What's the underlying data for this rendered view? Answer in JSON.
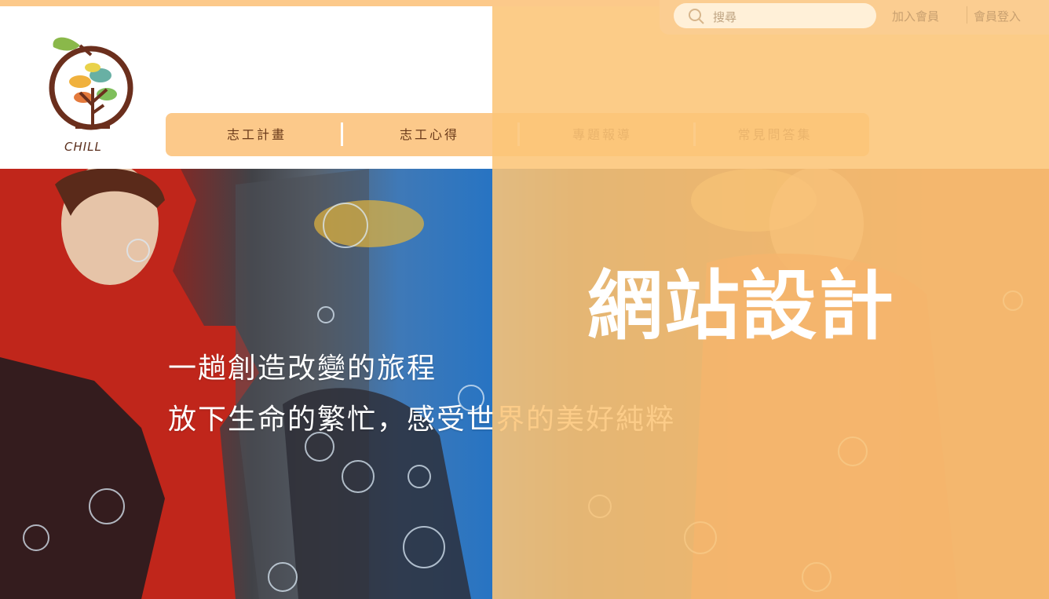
{
  "header": {
    "logo_text": "CHILL",
    "nav": [
      {
        "label": "志工計畫"
      },
      {
        "label": "志工心得"
      },
      {
        "label": "專題報導"
      },
      {
        "label": "常見問答集"
      }
    ],
    "search": {
      "placeholder": "搜尋"
    },
    "links": {
      "join": "加入會員",
      "login": "會員登入"
    }
  },
  "hero": {
    "line1": "一趟創造改變的旅程",
    "line2": "放下生命的繁忙，感受世界的美好純粹"
  },
  "overlay": {
    "title": "網站設計"
  },
  "colors": {
    "accent": "#fcc98a",
    "nav_text": "#6a3a1a",
    "logo_brown": "#6b2f1d"
  }
}
